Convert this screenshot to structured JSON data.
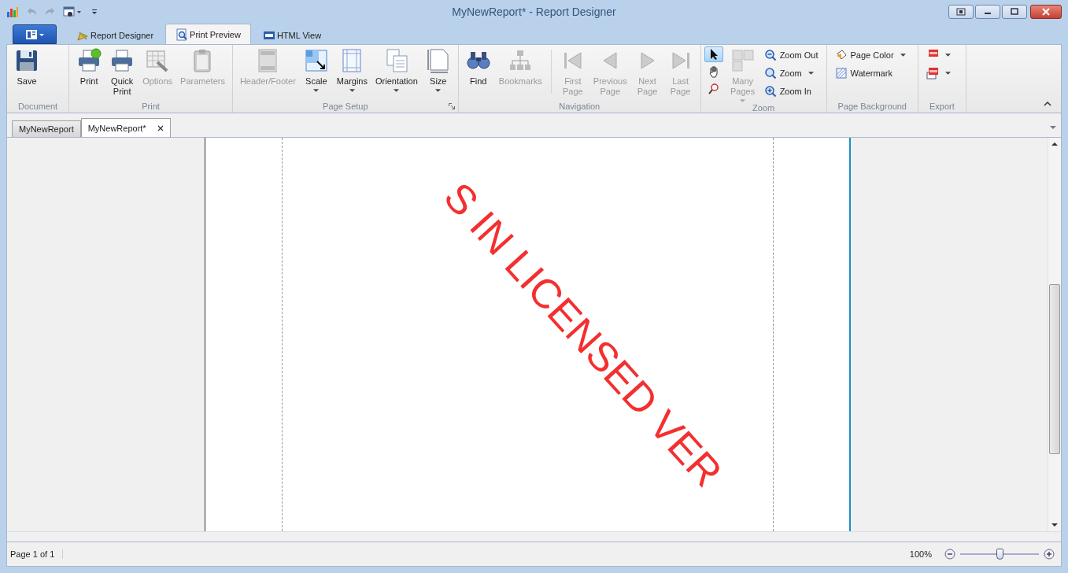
{
  "window": {
    "title": "MyNewReport* - Report Designer"
  },
  "ribbon": {
    "tabs": [
      {
        "label": "Report Designer",
        "selected": false
      },
      {
        "label": "Print Preview",
        "selected": true
      },
      {
        "label": "HTML View",
        "selected": false
      }
    ],
    "groups": [
      {
        "label": "Document",
        "items": [
          {
            "kind": "large",
            "label": "Save",
            "disabled": false,
            "dropdown": false
          }
        ]
      },
      {
        "label": "Print",
        "items": [
          {
            "kind": "large",
            "label": "Print",
            "disabled": false,
            "dropdown": false
          },
          {
            "kind": "large",
            "label": "Quick Print",
            "disabled": false,
            "dropdown": false
          },
          {
            "kind": "large",
            "label": "Options",
            "disabled": true,
            "dropdown": false
          },
          {
            "kind": "large",
            "label": "Parameters",
            "disabled": true,
            "dropdown": false
          }
        ]
      },
      {
        "label": "Page Setup",
        "launcher": true,
        "items": [
          {
            "kind": "large",
            "label": "Header/Footer",
            "disabled": true,
            "dropdown": false
          },
          {
            "kind": "large",
            "label": "Scale",
            "disabled": false,
            "dropdown": true
          },
          {
            "kind": "large",
            "label": "Margins",
            "disabled": false,
            "dropdown": true
          },
          {
            "kind": "large",
            "label": "Orientation",
            "disabled": false,
            "dropdown": true
          },
          {
            "kind": "large",
            "label": "Size",
            "disabled": false,
            "dropdown": true
          }
        ]
      },
      {
        "label": "Navigation",
        "items": [
          {
            "kind": "large",
            "label": "Find",
            "disabled": false,
            "dropdown": false
          },
          {
            "kind": "large",
            "label": "Bookmarks",
            "disabled": true,
            "dropdown": false
          },
          {
            "kind": "separator"
          },
          {
            "kind": "large",
            "label": "First Page",
            "disabled": true,
            "dropdown": false
          },
          {
            "kind": "large",
            "label": "Previous Page",
            "disabled": true,
            "dropdown": false
          },
          {
            "kind": "large",
            "label": "Next Page",
            "disabled": true,
            "dropdown": false
          },
          {
            "kind": "large",
            "label": "Last Page",
            "disabled": true,
            "dropdown": false
          }
        ]
      },
      {
        "label": "Zoom",
        "items": [
          {
            "kind": "tools",
            "tools": [
              {
                "selected": true
              },
              {
                "selected": false
              },
              {
                "selected": false
              }
            ]
          },
          {
            "kind": "large",
            "label": "Many Pages",
            "disabled": true,
            "dropdown": true
          },
          {
            "kind": "small",
            "entries": [
              {
                "label": "Zoom Out",
                "dropdown": false
              },
              {
                "label": "Zoom",
                "dropdown": true
              },
              {
                "label": "Zoom In",
                "dropdown": false
              }
            ]
          }
        ]
      },
      {
        "label": "Page Background",
        "items": [
          {
            "kind": "small",
            "entries": [
              {
                "label": "Page Color",
                "dropdown": true
              },
              {
                "label": "Watermark",
                "dropdown": false
              }
            ]
          }
        ]
      },
      {
        "label": "Export",
        "items": [
          {
            "kind": "iconstack",
            "entries": [
              {
                "dropdown": true
              },
              {
                "dropdown": true
              }
            ]
          }
        ]
      }
    ]
  },
  "documents": {
    "tabs": [
      {
        "label": "MyNewReport",
        "selected": false
      },
      {
        "label": "MyNewReport*",
        "selected": true
      }
    ]
  },
  "preview": {
    "watermark": "S IN LICENSED VER"
  },
  "status_bar": {
    "page": "Page 1 of 1",
    "zoom": "100%",
    "zoom_slider": {
      "level": 0.5
    }
  }
}
